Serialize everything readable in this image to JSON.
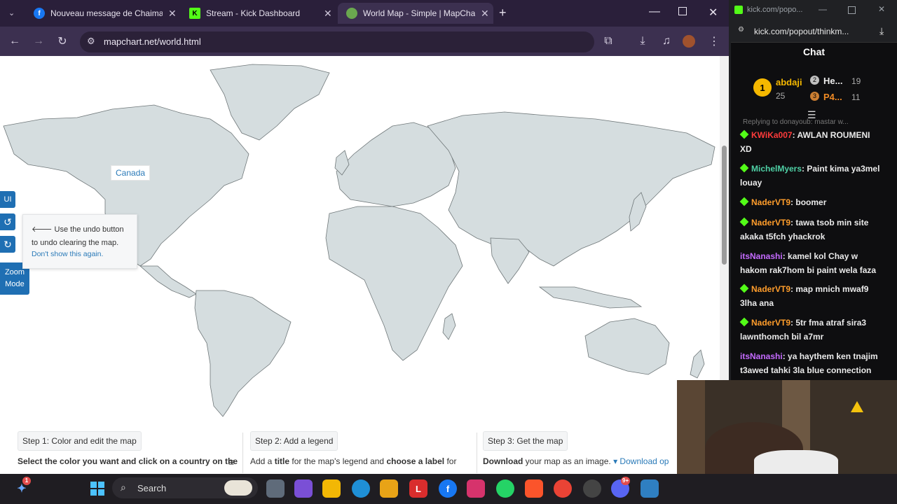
{
  "browser": {
    "tabs": [
      {
        "title": "Nouveau message de Chaima c",
        "favicon_color": "#1877f2",
        "favicon_glyph": "f"
      },
      {
        "title": "Stream - Kick Dashboard",
        "favicon_color": "#53fc18",
        "favicon_glyph": "K"
      },
      {
        "title": "World Map - Simple | MapChart",
        "favicon_color": "#6aa84f",
        "favicon_glyph": "●"
      }
    ],
    "url": "mapchart.net/world.html"
  },
  "map": {
    "hover_label": "Canada",
    "side_buttons": {
      "ui": "UI",
      "undo": "↺",
      "redo": "↻",
      "zoom": "Zoom Mode"
    },
    "tooltip": {
      "text": "🡐 Use the undo button to undo clearing the map.",
      "link": "Don't show this again."
    }
  },
  "steps": [
    {
      "title": "Step 1: Color and edit the map",
      "desc_pre": "Select the color you want and click on a country on the"
    },
    {
      "title": "Step 2: Add a legend",
      "desc_pre": "Add a ",
      "desc_bold": "title",
      "desc_mid": " for the map's legend and ",
      "desc_bold2": "choose a label",
      "desc_post": " for"
    },
    {
      "title": "Step 3: Get the map",
      "desc_bold": "Download",
      "desc_post": " your map as an image.",
      "link": "▾ Download op"
    }
  ],
  "kick": {
    "window_title": "kick.com/popo...",
    "url": "kick.com/popout/thinkm...",
    "chat_title": "Chat",
    "leaderboard": [
      {
        "rank": "1",
        "name": "abdaji",
        "count": "25"
      },
      {
        "rank": "2",
        "name": "He...",
        "count": "19"
      },
      {
        "rank": "3",
        "name": "P4...",
        "count": "11"
      }
    ],
    "reply_hint": "Replying to donayoub: mastar w...",
    "messages": [
      {
        "user": "KWiKa007",
        "color": "#ff3b3b",
        "badge": true,
        "text": ": AWLAN ROUMENI XD"
      },
      {
        "user": "MichelMyers",
        "color": "#4fd1a6",
        "badge": true,
        "text": ": Paint kima ya3mel louay"
      },
      {
        "user": "NaderVT9",
        "color": "#ff9d2b",
        "badge": true,
        "text": ": boomer"
      },
      {
        "user": "NaderVT9",
        "color": "#ff9d2b",
        "badge": true,
        "text": ": tawa tsob min site akaka t5fch yhackrok"
      },
      {
        "user": "itsNanashi",
        "color": "#c56bff",
        "badge": false,
        "text": ": kamel kol Chay w hakom rak7hom bi paint wela faza"
      },
      {
        "user": "NaderVT9",
        "color": "#ff9d2b",
        "badge": true,
        "text": ": map mnich mwaf9 3lha ana"
      },
      {
        "user": "NaderVT9",
        "color": "#ff9d2b",
        "badge": true,
        "text": ": 5tr fma atraf sira3 lawnthomch bil a7mr"
      },
      {
        "user": "itsNanashi",
        "color": "#c56bff",
        "badge": false,
        "text": ": ya haythem ken tnajim t3awed tahki 3la blue connection"
      }
    ]
  },
  "taskbar": {
    "search_label": "Search",
    "notification_count": "1",
    "discord_badge": "9+"
  }
}
